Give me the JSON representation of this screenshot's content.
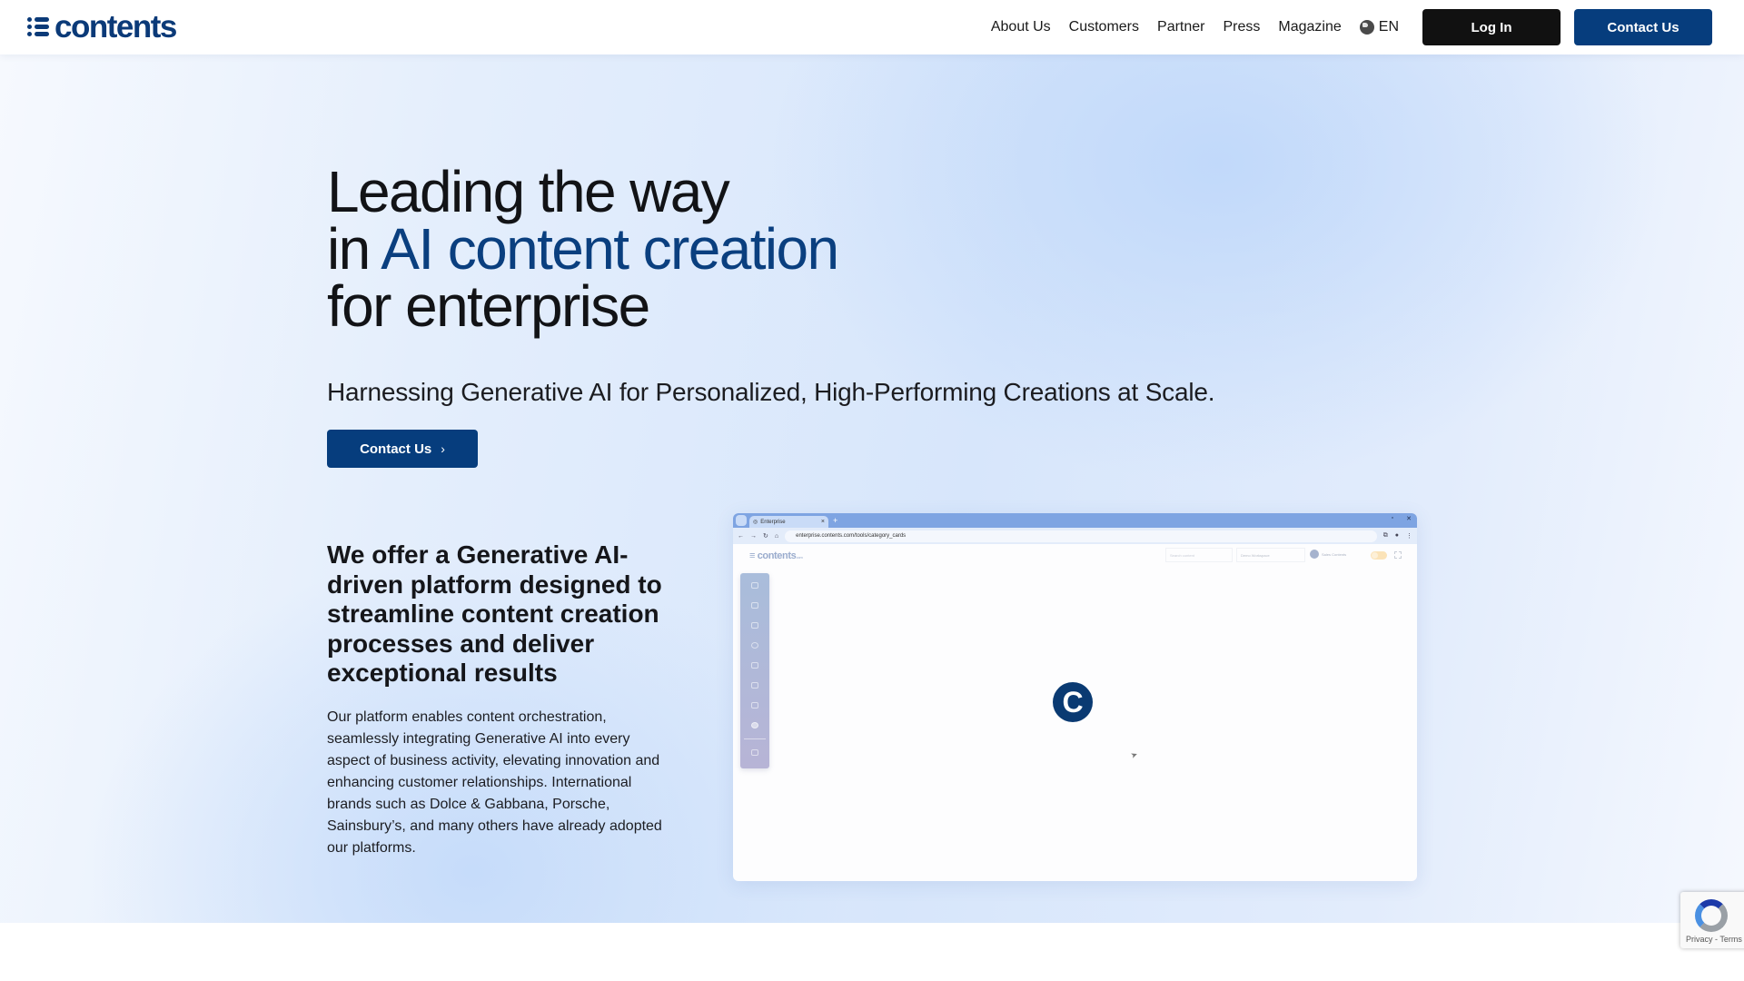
{
  "header": {
    "logo_text": "contents",
    "nav": [
      {
        "label": "About Us"
      },
      {
        "label": "Customers"
      },
      {
        "label": "Partner"
      },
      {
        "label": "Press"
      },
      {
        "label": "Magazine"
      }
    ],
    "language": {
      "icon": "globe-icon",
      "label": "EN"
    },
    "login_label": "Log In",
    "contact_label": "Contact Us"
  },
  "hero": {
    "title_line1": "Leading the way",
    "title_line2_prefix": "in ",
    "title_line2_accent": "AI content creation",
    "title_line3": "for enterprise",
    "subtitle": "Harnessing Generative AI for Personalized, High-Performing Creations at Scale.",
    "cta_label": "Contact Us",
    "cta_icon": "chevron-right-icon",
    "accent_color": "#0a3f7f"
  },
  "offer": {
    "title": "We offer a Generative AI-driven platform designed to streamline content creation processes and deliver exceptional results",
    "body": "Our platform enables content orchestration, seamlessly integrating Generative AI into every aspect of business activity, elevating innovation and enhancing customer relationships. International brands such as Dolce & Gabbana, Porsche, Sainsbury’s, and many others have already adopted our platforms."
  },
  "mockup": {
    "tab_title": "Enterprise",
    "url": "enterprise.contents.com/tools/category_cards",
    "app_logo": "contents",
    "app_logo_suffix": ".com",
    "search_placeholder": "Search content",
    "workspace": "Demo Workspace",
    "user": "Sales Contents",
    "loader_letter": "C",
    "sidebar_icons": [
      "grid-icon",
      "bot-icon",
      "trend-icon",
      "globe-icon",
      "edit-icon",
      "scan-icon",
      "document-icon",
      "web-icon",
      "folder-icon"
    ]
  },
  "recaptcha": {
    "label": "Privacy - Terms"
  },
  "colors": {
    "brand": "#063d7d",
    "login": "#111111"
  }
}
